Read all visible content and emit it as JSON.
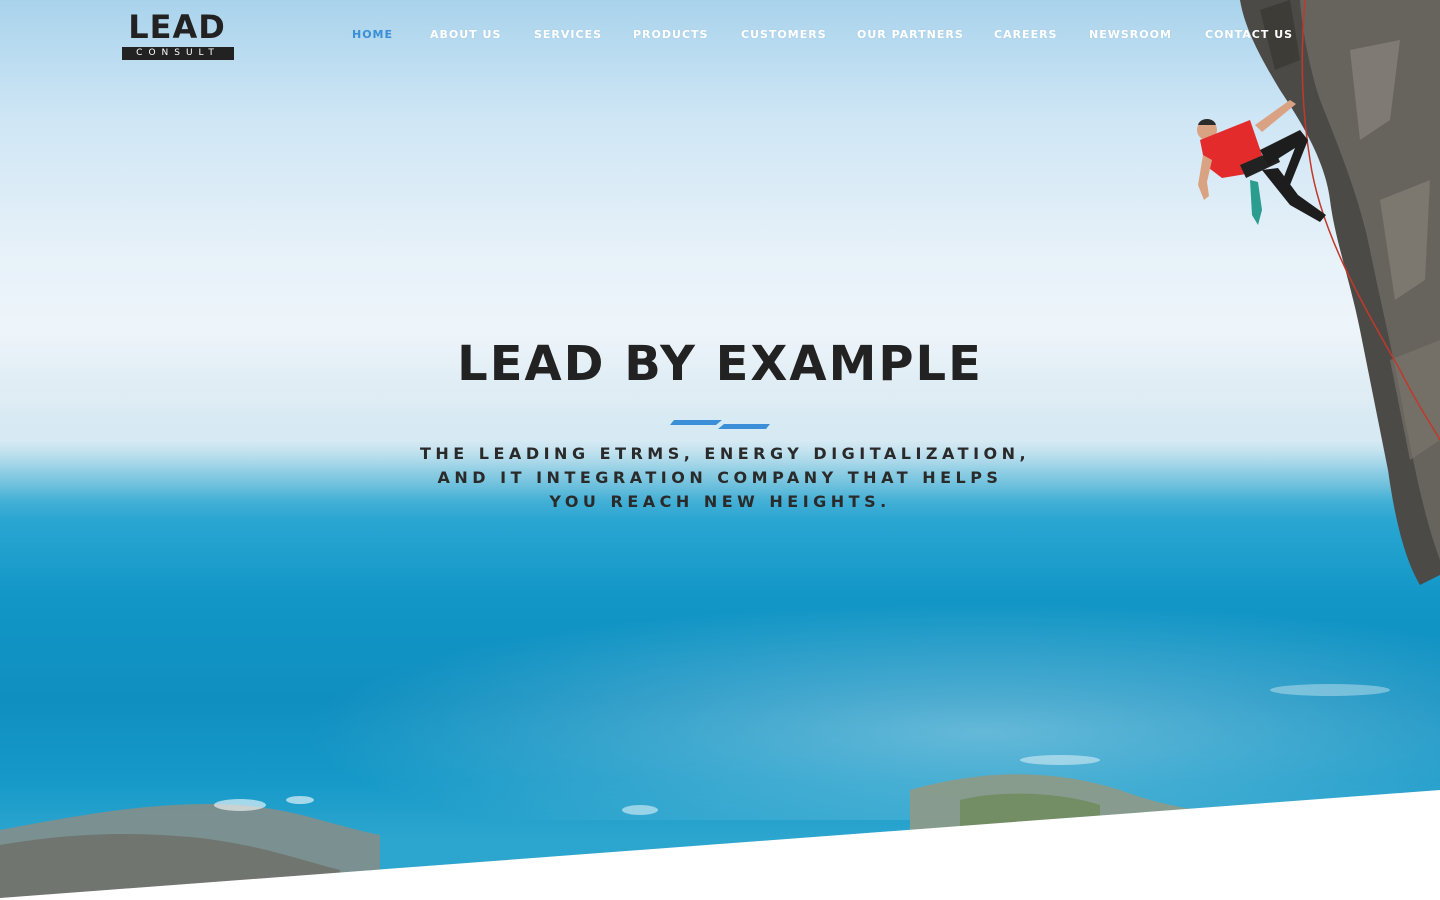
{
  "brand": {
    "logo_word": "LEAD",
    "logo_sub": "CONSULT"
  },
  "nav": {
    "items": [
      {
        "label": "HOME",
        "active": true
      },
      {
        "label": "ABOUT US",
        "active": false
      },
      {
        "label": "SERVICES",
        "active": false
      },
      {
        "label": "PRODUCTS",
        "active": false
      },
      {
        "label": "CUSTOMERS",
        "active": false
      },
      {
        "label": "OUR PARTNERS",
        "active": false
      },
      {
        "label": "CAREERS",
        "active": false
      },
      {
        "label": "NEWSROOM",
        "active": false
      },
      {
        "label": "CONTACT US",
        "active": false
      }
    ]
  },
  "hero": {
    "headline": "LEAD BY EXAMPLE",
    "tagline_lines": [
      "THE LEADING ETRMS, ENERGY DIGITALIZATION,",
      "AND IT INTEGRATION COMPANY THAT HELPS",
      "YOU REACH NEW HEIGHTS."
    ],
    "image_subject": "rock climber on cliff above ocean"
  },
  "colors": {
    "accent": "#3b8fd9",
    "text_dark": "#222222",
    "nav_text": "#ffffff",
    "climber_shirt": "#e32b2b"
  }
}
